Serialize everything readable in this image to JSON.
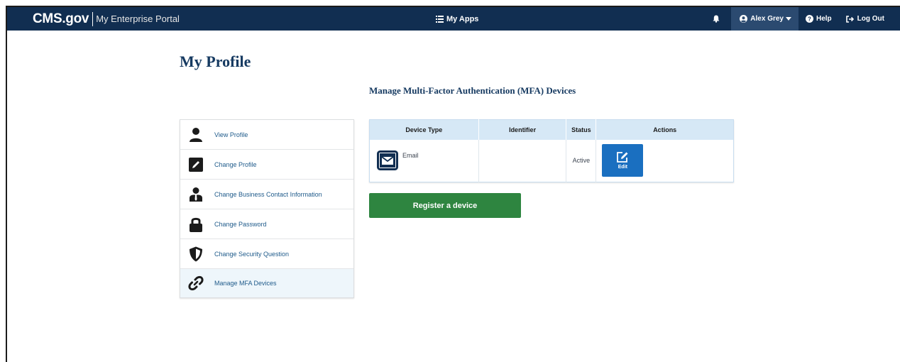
{
  "header": {
    "brand_logo": "CMS.gov",
    "portal_name": "My Enterprise Portal",
    "my_apps_label": "My Apps",
    "user_name": "Alex Grey",
    "help_label": "Help",
    "logout_label": "Log Out",
    "bg_color": "#112e51"
  },
  "page": {
    "title": "My Profile"
  },
  "sidebar": {
    "items": [
      {
        "label": "View Profile",
        "icon": "user-icon"
      },
      {
        "label": "Change Profile",
        "icon": "pencil-icon"
      },
      {
        "label": "Change Business Contact Information",
        "icon": "business-user-icon"
      },
      {
        "label": "Change Password",
        "icon": "lock-icon"
      },
      {
        "label": "Change Security Question",
        "icon": "shield-icon"
      },
      {
        "label": "Manage MFA Devices",
        "icon": "link-icon",
        "active": true
      }
    ]
  },
  "mfa": {
    "section_title": "Manage Multi-Factor Authentication (MFA) Devices",
    "columns": [
      "Device Type",
      "Identifier",
      "Status",
      "Actions"
    ],
    "rows": [
      {
        "device_type": "Email",
        "identifier": "",
        "status": "Active",
        "action_label": "Edit",
        "icon": "envelope-icon"
      }
    ],
    "register_label": "Register a device",
    "register_color": "#2e8540",
    "edit_color": "#1a6fc0"
  }
}
